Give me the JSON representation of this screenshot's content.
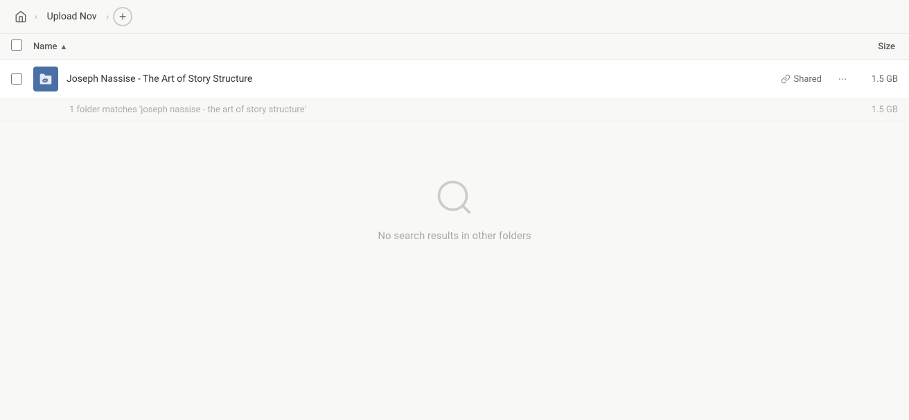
{
  "header": {
    "home_label": "Home",
    "breadcrumb_items": [
      {
        "label": "Upload Nov"
      }
    ],
    "add_button_label": "+"
  },
  "columns": {
    "name_label": "Name",
    "name_sort": "asc",
    "size_label": "Size"
  },
  "files": [
    {
      "name": "Joseph Nassise - The Art of Story Structure",
      "shared": true,
      "shared_label": "Shared",
      "size": "1.5 GB"
    }
  ],
  "match_info": {
    "text": "1 folder matches 'joseph nassise - the art of story structure'",
    "size": "1.5 GB"
  },
  "empty_state": {
    "message": "No search results in other folders"
  },
  "icons": {
    "home": "⌂",
    "chevron": "›",
    "link": "🔗",
    "more": "···",
    "sort_asc": "▲"
  }
}
